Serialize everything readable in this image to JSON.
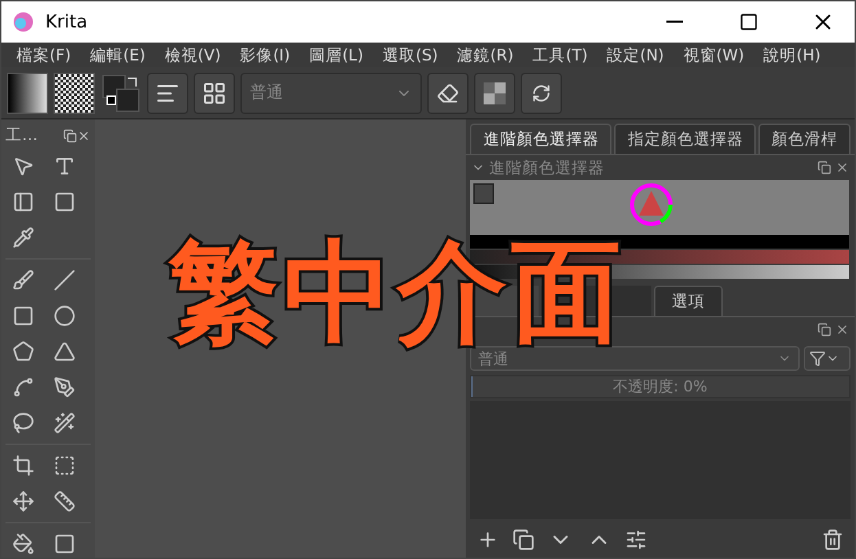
{
  "window": {
    "title": "Krita"
  },
  "menu": [
    "檔案(F)",
    "編輯(E)",
    "檢視(V)",
    "影像(I)",
    "圖層(L)",
    "選取(S)",
    "濾鏡(R)",
    "工具(T)",
    "設定(N)",
    "視窗(W)",
    "說明(H)"
  ],
  "toolbar": {
    "blend_mode": "普通"
  },
  "toolbox": {
    "title": "工…"
  },
  "color_docker": {
    "tabs": [
      {
        "label": "進階顏色選擇器",
        "selected": true
      },
      {
        "label": "指定顏色選擇器",
        "selected": false
      },
      {
        "label": "顏色滑桿",
        "selected": false
      }
    ],
    "title": "進階顏色選擇器"
  },
  "layers_docker": {
    "tabs": [
      {
        "label": "選項",
        "selected": false
      }
    ],
    "blend_mode": "普通",
    "opacity": {
      "text": "不透明度: 0%",
      "level": 0
    }
  },
  "overlay_caption": "繁中介面"
}
